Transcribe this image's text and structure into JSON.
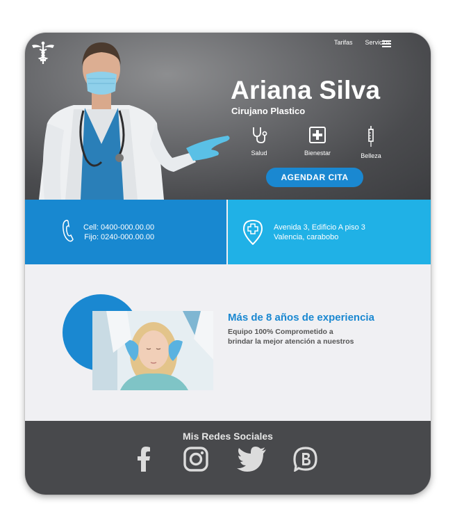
{
  "header": {
    "logo_icon": "caduceus-icon",
    "nav": [
      "Tarifas",
      "Servicios"
    ],
    "menu_icon": "hamburger-menu-icon"
  },
  "hero": {
    "name": "Ariana Silva",
    "title": "Cirujano Plastico",
    "features": [
      {
        "label": "Salud",
        "icon": "stethoscope-icon"
      },
      {
        "label": "Bienestar",
        "icon": "medical-cross-icon"
      },
      {
        "label": "Belleza",
        "icon": "syringe-icon"
      }
    ],
    "cta": "AGENDAR CITA"
  },
  "contact": {
    "phone_icon": "phone-icon",
    "cell": "Cell: 0400-000.00.00",
    "fijo": "Fijo: 0240-000.00.00",
    "location_icon": "location-cross-icon",
    "address_line1": "Avenida 3, Edificio A piso 3",
    "address_line2": "Valencia, carabobo"
  },
  "experience": {
    "heading": "Más de 8 años de experiencia",
    "text_line1": "Equipo 100% Comprometido a",
    "text_line2": "brindar la mejor atención a nuestros"
  },
  "social": {
    "title": "Mis Redes Sociales",
    "icons": [
      "facebook-icon",
      "instagram-icon",
      "twitter-icon",
      "blogger-icon"
    ]
  },
  "colors": {
    "primary_blue": "#1a88d1",
    "light_blue": "#20b1e6",
    "dark_gray": "#48494c",
    "background": "#f0f0f3"
  }
}
